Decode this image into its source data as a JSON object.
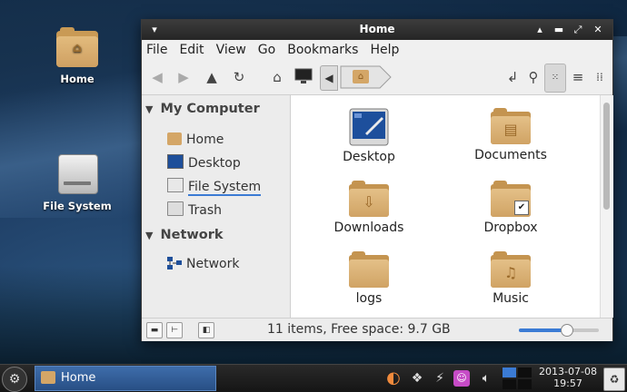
{
  "desktop": {
    "icons": [
      {
        "label": "Home"
      },
      {
        "label": "File System"
      }
    ]
  },
  "window": {
    "title": "Home",
    "menu": [
      "File",
      "Edit",
      "View",
      "Go",
      "Bookmarks",
      "Help"
    ],
    "sidebar": {
      "sections": [
        {
          "title": "My Computer",
          "items": [
            "Home",
            "Desktop",
            "File System",
            "Trash"
          ]
        },
        {
          "title": "Network",
          "items": [
            "Network"
          ]
        }
      ]
    },
    "files": [
      "Desktop",
      "Documents",
      "Downloads",
      "Dropbox",
      "logs",
      "Music"
    ],
    "status": "11 items, Free space: 9.7 GB",
    "zoom_level": 0.6
  },
  "taskbar": {
    "task_label": "Home",
    "date": "2013-07-08",
    "time": "19:57"
  },
  "colors": {
    "folder": "#d0a364",
    "accent": "#3b7bd4",
    "titlebar": "#2c2c2c"
  }
}
